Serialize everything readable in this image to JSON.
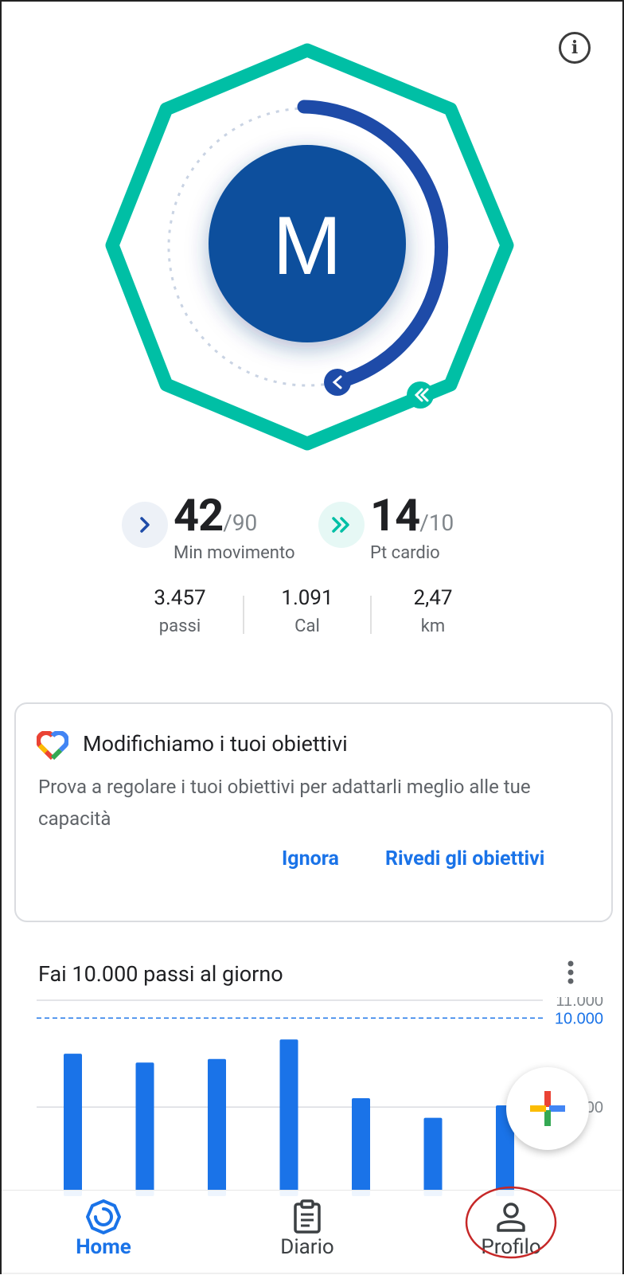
{
  "header": {
    "info_icon": "info-icon"
  },
  "ring": {
    "avatar_letter": "M"
  },
  "metrics": {
    "move_minutes": {
      "value": "42",
      "goal": "/90",
      "label": "Min movimento",
      "progress": 0.47
    },
    "heart_points": {
      "value": "14",
      "goal": "/10",
      "label": "Pt cardio",
      "progress": 1.4
    }
  },
  "stats": [
    {
      "value": "3.457",
      "label": "passi"
    },
    {
      "value": "1.091",
      "label": "Cal"
    },
    {
      "value": "2,47",
      "label": "km"
    }
  ],
  "goal_card": {
    "title": "Modifichiamo i tuoi obiettivi",
    "body": "Prova a regolare i tuoi obiettivi per adattarli meglio alle tue capacità",
    "dismiss_label": "Ignora",
    "review_label": "Rivedi gli obiettivi"
  },
  "steps_section": {
    "title": "Fai 10.000 passi al giorno"
  },
  "chart_data": {
    "type": "bar",
    "title": "Fai 10.000 passi al giorno",
    "values": [
      8000,
      7500,
      7700,
      8800,
      5500,
      4400,
      5100
    ],
    "y_tick_labels": [
      "11.000",
      "10.000",
      "5.000"
    ],
    "goal_line": 10000,
    "ylim": [
      0,
      11000
    ],
    "colors": {
      "bar": "#1a73e8",
      "goal_line": "#1a73e8"
    }
  },
  "fab": {
    "icon": "plus-icon"
  },
  "navbar": {
    "items": [
      {
        "label": "Home",
        "icon": "home-ring-icon",
        "active": true
      },
      {
        "label": "Diario",
        "icon": "clipboard-icon",
        "active": false
      },
      {
        "label": "Profilo",
        "icon": "person-icon",
        "active": false
      }
    ]
  },
  "colors": {
    "accent": "#1a73e8",
    "teal": "#00bfa5",
    "move_blue": "#1e4ba8",
    "avatar_bg": "#08509d"
  }
}
